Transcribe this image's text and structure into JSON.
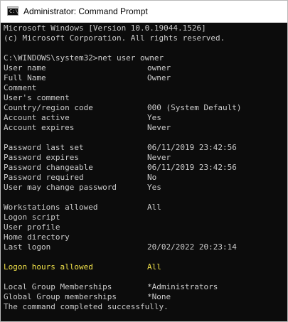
{
  "window": {
    "title": "Administrator: Command Prompt",
    "icon_text": "C:\\"
  },
  "console": {
    "header": [
      "Microsoft Windows [Version 10.0.19044.1526]",
      "(c) Microsoft Corporation. All rights reserved."
    ],
    "command": "C:\\WINDOWS\\system32>net user owner",
    "user_info": [
      {
        "label": "User name",
        "value": "owner"
      },
      {
        "label": "Full Name",
        "value": "Owner"
      },
      {
        "label": "Comment",
        "value": ""
      },
      {
        "label": "User's comment",
        "value": ""
      },
      {
        "label": "Country/region code",
        "value": "000 (System Default)"
      },
      {
        "label": "Account active",
        "value": "Yes"
      },
      {
        "label": "Account expires",
        "value": "Never"
      }
    ],
    "password_info": [
      {
        "label": "Password last set",
        "value": "06/11/2019 23:42:56"
      },
      {
        "label": "Password expires",
        "value": "Never"
      },
      {
        "label": "Password changeable",
        "value": "06/11/2019 23:42:56"
      },
      {
        "label": "Password required",
        "value": "No"
      },
      {
        "label": "User may change password",
        "value": "Yes"
      }
    ],
    "logon_info": [
      {
        "label": "Workstations allowed",
        "value": "All"
      },
      {
        "label": "Logon script",
        "value": ""
      },
      {
        "label": "User profile",
        "value": ""
      },
      {
        "label": "Home directory",
        "value": ""
      },
      {
        "label": "Last logon",
        "value": "20/02/2022 20:23:14"
      }
    ],
    "logon_hours": {
      "label": "Logon hours allowed",
      "value": "All"
    },
    "group_info": [
      {
        "label": "Local Group Memberships",
        "value": "*Administrators"
      },
      {
        "label": "Global Group memberships",
        "value": "*None"
      }
    ],
    "footer": "The command completed successfully."
  },
  "colors": {
    "console_background": "#0c0c0c",
    "console_text": "#cccccc",
    "highlight_text": "#f0e14a",
    "titlebar_background": "#ffffff"
  }
}
